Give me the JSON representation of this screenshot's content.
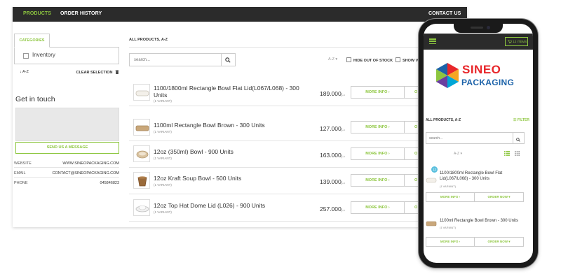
{
  "nav": {
    "products": "PRODUCTS",
    "order_history": "ORDER HISTORY",
    "contact_us": "CONTACT US"
  },
  "sidebar": {
    "categories_tab": "CATEGORIES",
    "category_item": "Inventory",
    "sort_label": "A-Z",
    "clear_selection": "CLEAR SELECTION",
    "get_in_touch": "Get in touch",
    "send_message": "SEND US A MESSAGE",
    "contact": [
      {
        "key": "WEBSITE",
        "value": "WWW.SINEOPACKAGING.COM"
      },
      {
        "key": "EMAIL",
        "value": "CONTACT@SINEOPACKAGING.COM"
      },
      {
        "key": "PHONE",
        "value": "045846823"
      }
    ]
  },
  "main": {
    "heading": "ALL PRODUCTS, A-Z",
    "search_placeholder": "search...",
    "sort_select": "A-Z",
    "hide_out_of_stock": "HIDE OUT OF STOCK",
    "show_variants": "SHOW VA",
    "more_info": "MORE INFO",
    "order_now": "O",
    "currency": "د.إ",
    "products": [
      {
        "name": "1100/1800ml Rectangle Bowl Flat Lid(L067/L068) - 300 Units",
        "variants": "(1 VARIANT)",
        "price": "189.000"
      },
      {
        "name": "1100ml Rectangle Bowl Brown - 300 Units",
        "variants": "(1 VARIANT)",
        "price": "127.000"
      },
      {
        "name": "12oz (350ml) Bowl - 900 Units",
        "variants": "(1 VARIANT)",
        "price": "163.000"
      },
      {
        "name": "12oz Kraft Soup Bowl - 500 Units",
        "variants": "(1 VARIANT)",
        "price": "139.000"
      },
      {
        "name": "12oz Top Hat Dome Lid (L026) - 900 Units",
        "variants": "(1 VARIANT)",
        "price": "257.000"
      }
    ]
  },
  "mobile": {
    "cart_label": "12 ITEMS",
    "logo_line1": "SINEO",
    "logo_line2": "PACKAGING",
    "heading": "ALL PRODUCTS, A-Z",
    "filter": "FILTER",
    "search_placeholder": "search...",
    "sort_select": "A-Z",
    "badge": "12",
    "more_info": "MORE INFO",
    "order_now": "ORDER NOW",
    "products": [
      {
        "name": "1100/1800ml Rectangle Bowl Flat Lid(L067/L068) - 300 Units",
        "variants": "(1 VARIANT)"
      },
      {
        "name": "1100ml Rectangle Bowl Brown - 300 Units",
        "variants": "(1 VARIANT)"
      }
    ]
  },
  "colors": {
    "accent": "#8dc63f",
    "nav_bg": "#2b2b2b",
    "logo_red": "#e8272b",
    "logo_blue": "#1d63a9"
  }
}
